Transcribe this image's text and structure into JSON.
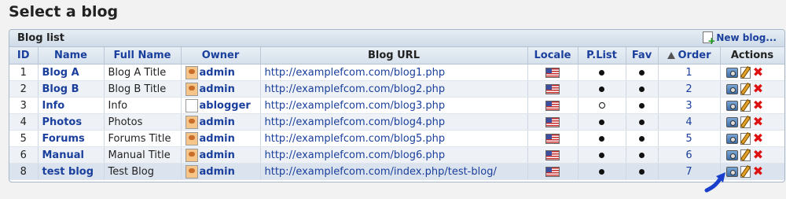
{
  "page": {
    "title": "Select a blog"
  },
  "panel": {
    "title": "Blog list",
    "new_blog_label": "New blog..."
  },
  "columns": {
    "id": "ID",
    "name": "Name",
    "full_name": "Full Name",
    "owner": "Owner",
    "blog_url": "Blog URL",
    "locale": "Locale",
    "plist": "P.List",
    "fav": "Fav",
    "order": "Order",
    "actions": "Actions"
  },
  "rows": [
    {
      "id": "1",
      "name": "Blog A",
      "full_name": "Blog A Title",
      "owner": "admin",
      "url": "http://examplefcom.com/blog1.php",
      "plist": true,
      "fav": true,
      "order": "1"
    },
    {
      "id": "2",
      "name": "Blog B",
      "full_name": "Blog B Title",
      "owner": "admin",
      "url": "http://examplefcom.com/blog2.php",
      "plist": true,
      "fav": true,
      "order": "2"
    },
    {
      "id": "3",
      "name": "Info",
      "full_name": "Info",
      "owner": "ablogger",
      "url": "http://examplefcom.com/blog3.php",
      "plist": false,
      "fav": true,
      "order": "3"
    },
    {
      "id": "4",
      "name": "Photos",
      "full_name": "Photos",
      "owner": "admin",
      "url": "http://examplefcom.com/blog4.php",
      "plist": true,
      "fav": true,
      "order": "4"
    },
    {
      "id": "5",
      "name": "Forums",
      "full_name": "Forums Title",
      "owner": "admin",
      "url": "http://examplefcom.com/blog5.php",
      "plist": true,
      "fav": true,
      "order": "5"
    },
    {
      "id": "6",
      "name": "Manual",
      "full_name": "Manual Title",
      "owner": "admin",
      "url": "http://examplefcom.com/blog6.php",
      "plist": true,
      "fav": true,
      "order": "6"
    },
    {
      "id": "8",
      "name": "test blog",
      "full_name": "Test Blog",
      "owner": "admin",
      "url": "http://examplefcom.com/index.php/test-blog/",
      "plist": true,
      "fav": true,
      "order": "7"
    }
  ],
  "icons": {
    "locale": "us-flag-icon",
    "actions": [
      "properties-icon",
      "edit-icon",
      "delete-icon"
    ]
  },
  "colors": {
    "link": "#1a3f9c",
    "delete": "#dd1111",
    "pointer": "#1a3fcc"
  }
}
